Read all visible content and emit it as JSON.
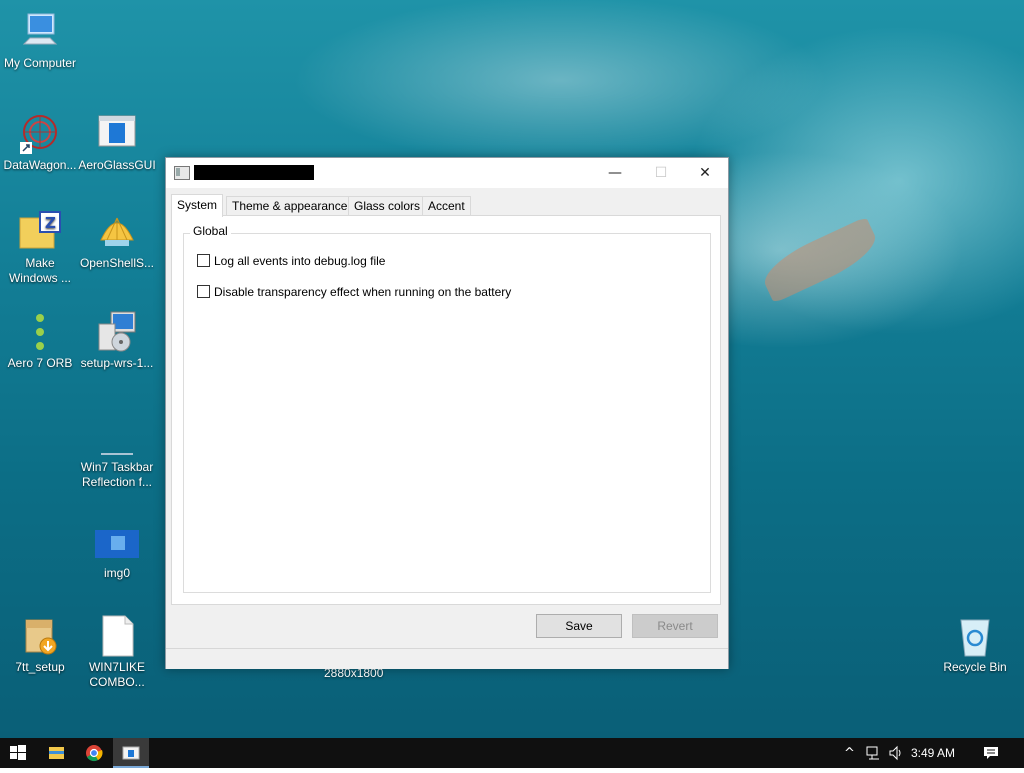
{
  "desktop": {
    "icons": [
      {
        "label": "My Computer",
        "icon": "computer-icon"
      },
      {
        "label": "DataWagon...",
        "icon": "datawagon-icon"
      },
      {
        "label": "AeroGlassGUI",
        "icon": "aeroglassgui-icon"
      },
      {
        "label": "Make\nWindows ...",
        "icon": "zip-folder-icon"
      },
      {
        "label": "OpenShellS...",
        "icon": "shell-icon"
      },
      {
        "label": "Aero 7 ORB",
        "icon": "orb-icon"
      },
      {
        "label": "setup-wrs-1...",
        "icon": "installer-icon"
      },
      {
        "label": "Win7 Taskbar\nReflection f...",
        "icon": "taskbar-reflection-icon"
      },
      {
        "label": "img0",
        "icon": "image-icon"
      },
      {
        "label": "7tt_setup",
        "icon": "setup-box-icon"
      },
      {
        "label": "WIN7LIKE\nCOMBO...",
        "icon": "document-icon"
      },
      {
        "label": "Recycle Bin",
        "icon": "recycle-bin-icon"
      }
    ],
    "wallpaper_text": "2880x1800"
  },
  "window": {
    "title_redacted": true,
    "controls": {
      "minimize": "—",
      "maximize": "☐",
      "close": "✕"
    },
    "tabs": [
      {
        "label": "System",
        "active": true
      },
      {
        "label": "Theme & appearance",
        "active": false
      },
      {
        "label": "Glass colors",
        "active": false
      },
      {
        "label": "Accent",
        "active": false
      }
    ],
    "group": {
      "title": "Global",
      "options": [
        {
          "label": "Log all events into debug.log file",
          "checked": false
        },
        {
          "label": "Disable transparency effect when running on the battery",
          "checked": false
        }
      ]
    },
    "buttons": {
      "save": "Save",
      "revert": "Revert"
    }
  },
  "taskbar": {
    "items": [
      "start-icon",
      "file-explorer-icon",
      "chrome-icon",
      "aeroglass-app-icon"
    ],
    "tray": {
      "chevron": "^",
      "network": "network-icon",
      "volume": "volume-icon",
      "notifications": "notifications-icon"
    },
    "clock": "3:49 AM"
  }
}
